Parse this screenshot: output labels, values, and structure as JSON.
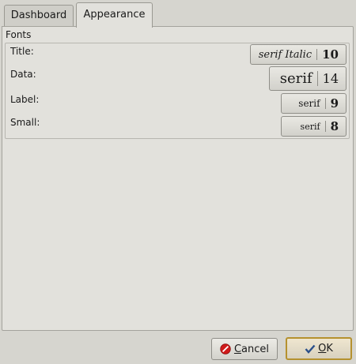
{
  "tabs": [
    {
      "label": "Dashboard",
      "active": false
    },
    {
      "label": "Appearance",
      "active": true
    }
  ],
  "fonts_group": {
    "title": "Fonts",
    "rows": [
      {
        "label": "Title:",
        "font_name": "serif Italic",
        "font_size": "10",
        "italic": true
      },
      {
        "label": "Data:",
        "font_name": "serif",
        "font_size": "14",
        "italic": false
      },
      {
        "label": "Label:",
        "font_name": "serif",
        "font_size": "9",
        "italic": false
      },
      {
        "label": "Small:",
        "font_name": "serif",
        "font_size": "8",
        "italic": false
      }
    ]
  },
  "buttons": {
    "cancel": {
      "first": "C",
      "rest": "ancel",
      "icon": "cancel-icon",
      "icon_color": "#d01a1a"
    },
    "ok": {
      "first": "O",
      "rest": "K",
      "icon": "checkmark-icon",
      "icon_color": "#2a4f8a"
    }
  },
  "colors": {
    "window_bg": "#d6d5cf",
    "panel_bg": "#e2e1dc",
    "ok_border": "#b5912f"
  }
}
